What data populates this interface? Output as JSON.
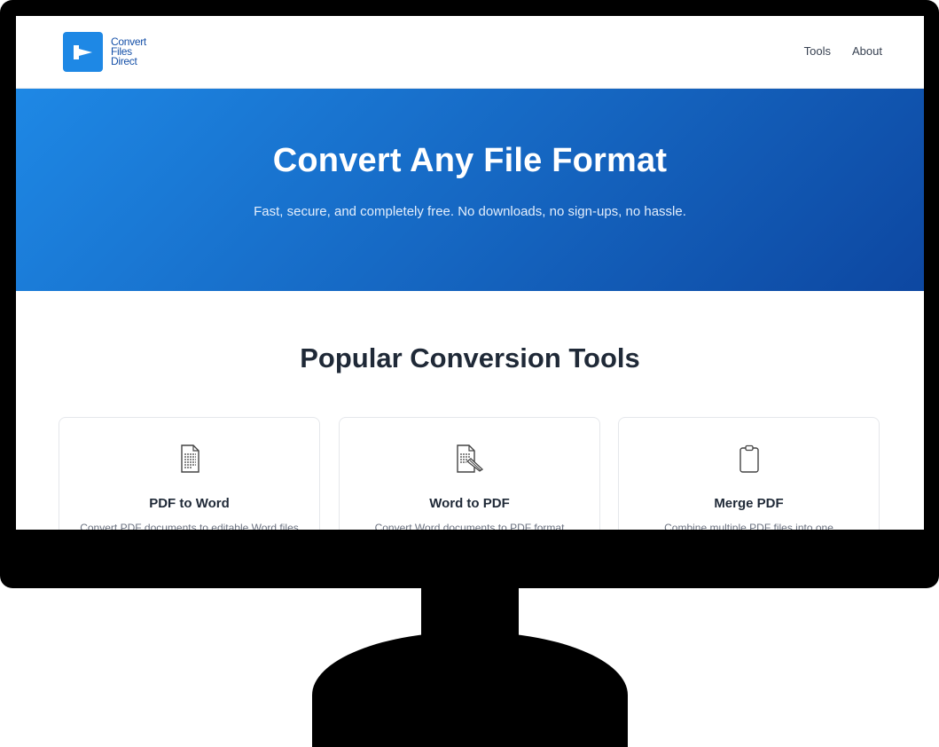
{
  "header": {
    "logo_lines": [
      "Convert",
      "Files",
      "Direct"
    ],
    "nav": [
      {
        "label": "Tools"
      },
      {
        "label": "About"
      }
    ]
  },
  "hero": {
    "title": "Convert Any File Format",
    "subtitle": "Fast, secure, and completely free. No downloads, no sign-ups, no hassle."
  },
  "tools": {
    "heading": "Popular Conversion Tools",
    "cards": [
      {
        "icon": "document-icon",
        "title": "PDF to Word",
        "description": "Convert PDF documents to editable Word files"
      },
      {
        "icon": "document-pen-icon",
        "title": "Word to PDF",
        "description": "Convert Word documents to PDF format"
      },
      {
        "icon": "clipboard-icon",
        "title": "Merge PDF",
        "description": "Combine multiple PDF files into one"
      }
    ]
  },
  "colors": {
    "brand": "#1e88e5",
    "hero_start": "#1e88e5",
    "hero_end": "#0d47a1",
    "text_dark": "#1f2937"
  }
}
